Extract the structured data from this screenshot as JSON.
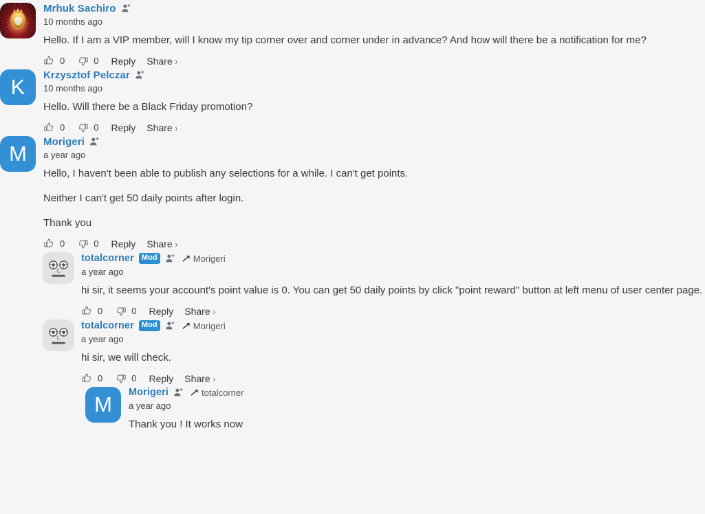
{
  "theme": {
    "background": "#f5f5f5",
    "username_color": "#2e7cb8",
    "mod_badge_bg": "#2b8fd4",
    "avatar_blue": "#3490d4",
    "text_color": "#37393b"
  },
  "actions": {
    "like_count": "0",
    "dislike_count": "0",
    "reply_label": "Reply",
    "share_label": "Share"
  },
  "comments": [
    {
      "id": "c1",
      "level": 0,
      "avatar_type": "crest",
      "avatar_letter": "",
      "username": "Mrhuk Sachiro",
      "is_mod": false,
      "mod_label": "",
      "reply_to": "",
      "time": "10 months ago",
      "paragraphs": [
        "Hello. If I am a VIP member, will I know my tip corner over and corner under in advance? And how will there be a notification for me?"
      ],
      "like_count": "0",
      "dislike_count": "0",
      "reply_label": "Reply",
      "share_label": "Share"
    },
    {
      "id": "c2",
      "level": 0,
      "avatar_type": "letter",
      "avatar_letter": "K",
      "username": "Krzysztof Pelczar",
      "is_mod": false,
      "mod_label": "",
      "reply_to": "",
      "time": "10 months ago",
      "paragraphs": [
        "Hello. Will there be a Black Friday promotion?"
      ],
      "like_count": "0",
      "dislike_count": "0",
      "reply_label": "Reply",
      "share_label": "Share"
    },
    {
      "id": "c3",
      "level": 0,
      "avatar_type": "letter",
      "avatar_letter": "M",
      "username": "Morigeri",
      "is_mod": false,
      "mod_label": "",
      "reply_to": "",
      "time": "a year ago",
      "paragraphs": [
        "Hello, I haven't been able to publish any selections for a while. I can't get points.",
        "Neither I can't get 50 daily points after login.",
        "Thank you"
      ],
      "like_count": "0",
      "dislike_count": "0",
      "reply_label": "Reply",
      "share_label": "Share"
    },
    {
      "id": "c4",
      "level": 1,
      "avatar_type": "soccer",
      "avatar_letter": "",
      "username": "totalcorner",
      "is_mod": true,
      "mod_label": "Mod",
      "reply_to": "Morigeri",
      "time": "a year ago",
      "paragraphs": [
        "hi sir, it seems your account's point value is 0. You can get 50 daily points by click \"point reward\" button at left menu of user center page."
      ],
      "like_count": "0",
      "dislike_count": "0",
      "reply_label": "Reply",
      "share_label": "Share"
    },
    {
      "id": "c5",
      "level": 1,
      "avatar_type": "soccer",
      "avatar_letter": "",
      "username": "totalcorner",
      "is_mod": true,
      "mod_label": "Mod",
      "reply_to": "Morigeri",
      "time": "a year ago",
      "paragraphs": [
        "hi sir, we will check."
      ],
      "like_count": "0",
      "dislike_count": "0",
      "reply_label": "Reply",
      "share_label": "Share"
    },
    {
      "id": "c6",
      "level": 2,
      "avatar_type": "letter",
      "avatar_letter": "M",
      "username": "Morigeri",
      "is_mod": false,
      "mod_label": "",
      "reply_to": "totalcorner",
      "time": "a year ago",
      "paragraphs": [
        "Thank you ! It works now"
      ],
      "like_count": "",
      "dislike_count": "",
      "reply_label": "",
      "share_label": ""
    }
  ]
}
